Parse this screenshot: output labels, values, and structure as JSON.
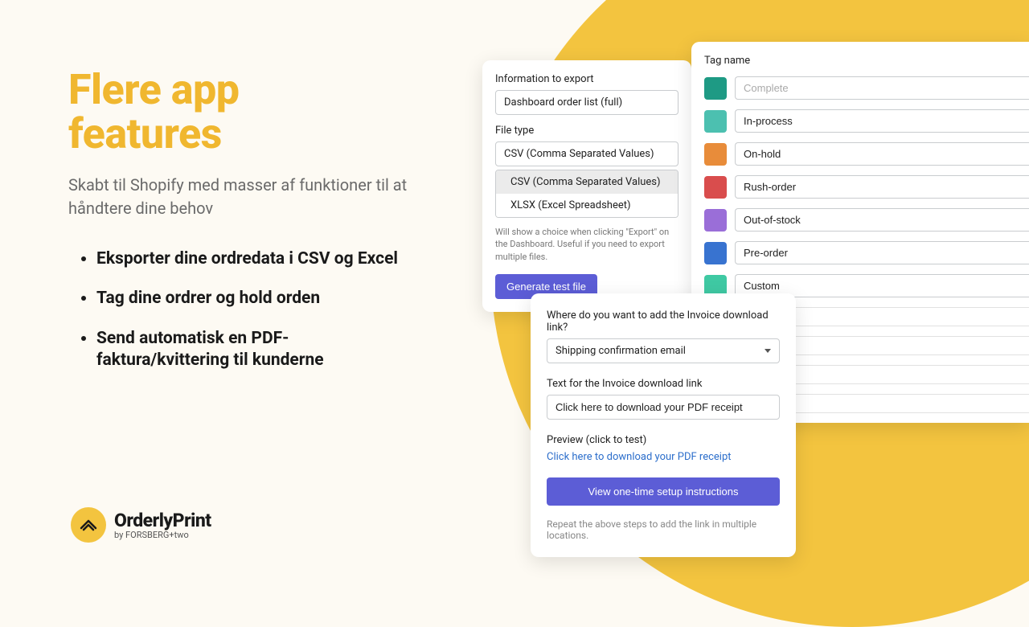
{
  "left": {
    "headline_l1": "Flere app",
    "headline_l2": "features",
    "subhead": "Skabt til Shopify med masser af funktioner til at håndtere dine behov",
    "features": [
      "Eksporter dine ordredata i CSV og Excel",
      "Tag dine ordrer og hold orden",
      "Send automatisk en PDF-faktura/kvittering til kunderne"
    ]
  },
  "logo": {
    "name": "OrderlyPrint",
    "by": "by FORSBERG+two"
  },
  "export": {
    "info_label": "Information to export",
    "info_value": "Dashboard order list (full)",
    "file_label": "File type",
    "file_value": "CSV (Comma Separated Values)",
    "options": [
      "CSV (Comma Separated Values)",
      "XLSX (Excel Spreadsheet)"
    ],
    "helper": "Will show a choice when clicking \"Export\" on the Dashboard. Useful if you need to export multiple files.",
    "button": "Generate test file"
  },
  "tags": {
    "label": "Tag name",
    "items": [
      {
        "name": "Complete",
        "placeholder": true,
        "color": "#1e9a84"
      },
      {
        "name": "In-process",
        "placeholder": false,
        "color": "#4cc0b0"
      },
      {
        "name": "On-hold",
        "placeholder": false,
        "color": "#e88c3a"
      },
      {
        "name": "Rush-order",
        "placeholder": false,
        "color": "#d94d4d"
      },
      {
        "name": "Out-of-stock",
        "placeholder": false,
        "color": "#9a6ed8"
      },
      {
        "name": "Pre-order",
        "placeholder": false,
        "color": "#3873d0"
      },
      {
        "name": "Custom",
        "placeholder": false,
        "color": "#3fc9a3"
      }
    ]
  },
  "invoice": {
    "where_label": "Where do you want to add the Invoice download link?",
    "where_value": "Shipping confirmation email",
    "text_label": "Text for the Invoice download link",
    "text_value": "Click here to download your PDF receipt",
    "preview_label": "Preview (click to test)",
    "preview_link": "Click here to download your PDF receipt",
    "button": "View one-time setup instructions",
    "repeat": "Repeat the above steps to add the link in multiple locations."
  }
}
